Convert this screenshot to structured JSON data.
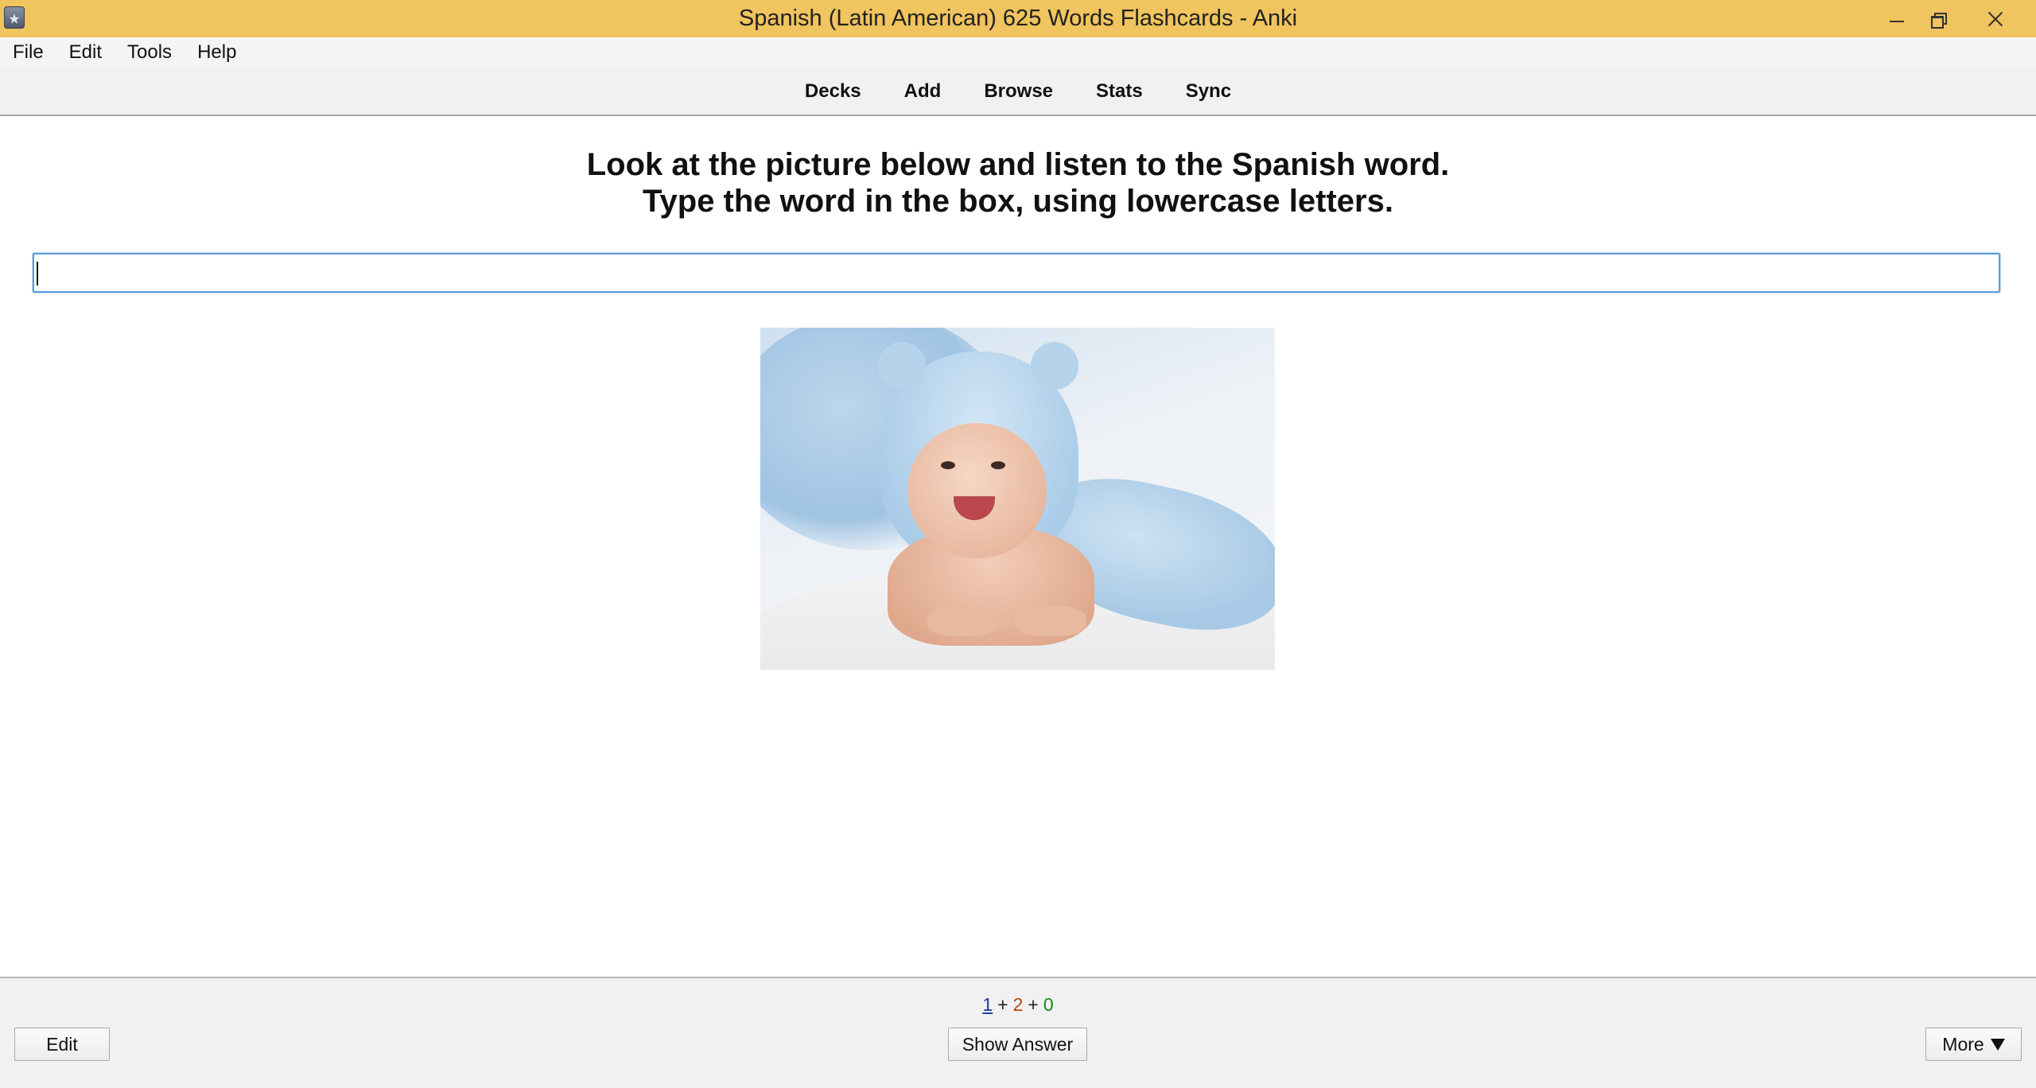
{
  "window": {
    "title": "Spanish (Latin American) 625 Words Flashcards - Anki",
    "title_bar_color": "#f0c45e"
  },
  "menu": {
    "items": [
      "File",
      "Edit",
      "Tools",
      "Help"
    ]
  },
  "toolbar": {
    "items": [
      "Decks",
      "Add",
      "Browse",
      "Stats",
      "Sync"
    ]
  },
  "card": {
    "instruction_line1": "Look at the picture below and listen to the Spanish word.",
    "instruction_line2": "Type the word in the box, using lowercase letters.",
    "answer_value": "",
    "image_subject": "smiling-baby-in-blue-hooded-towel"
  },
  "counts": {
    "new": "1",
    "learning": "2",
    "review": "0",
    "separator": "+",
    "colors": {
      "new": "#1f3aa8",
      "learning": "#c2410c",
      "review": "#148a14"
    }
  },
  "buttons": {
    "edit": "Edit",
    "show_answer": "Show Answer",
    "more": "More"
  },
  "icons": {
    "app": "anki-star-icon",
    "minimize": "minimize-icon",
    "maximize": "restore-icon",
    "close": "close-icon",
    "more_dropdown": "triangle-down-icon"
  }
}
